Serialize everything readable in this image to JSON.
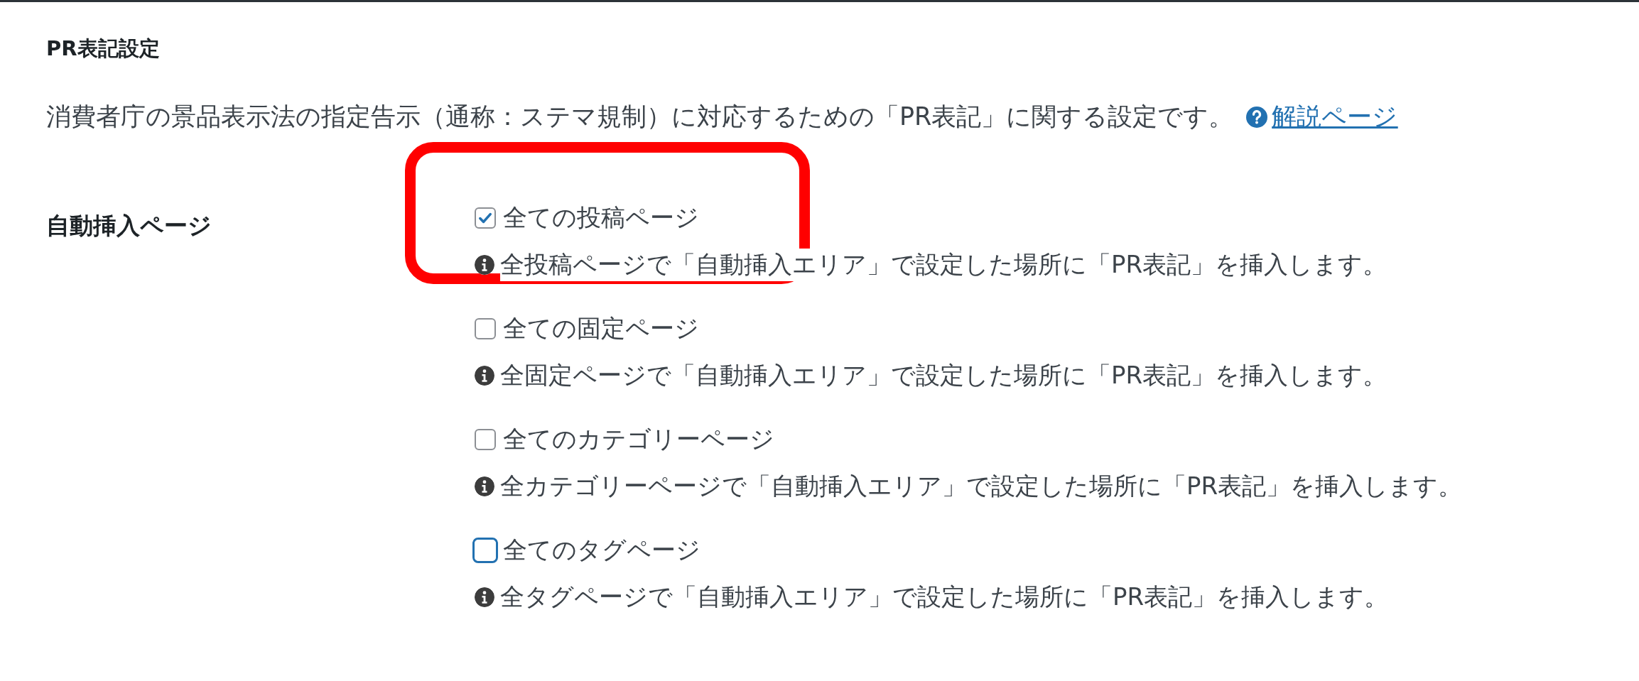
{
  "heading": "PR表記設定",
  "description": {
    "text": "消費者庁の景品表示法の指定告示（通称：ステマ規制）に対応するための「PR表記」に関する設定です。",
    "link": "解説ページ"
  },
  "field": {
    "label": "自動挿入ページ",
    "options": [
      {
        "label": "全ての投稿ページ",
        "checked": true,
        "focused": false,
        "highlighted": true,
        "help": "全投稿ページで「自動挿入エリア」で設定した場所に「PR表記」を挿入します。"
      },
      {
        "label": "全ての固定ページ",
        "checked": false,
        "focused": false,
        "highlighted": false,
        "help": "全固定ページで「自動挿入エリア」で設定した場所に「PR表記」を挿入します。"
      },
      {
        "label": "全てのカテゴリーページ",
        "checked": false,
        "focused": false,
        "highlighted": false,
        "help": "全カテゴリーページで「自動挿入エリア」で設定した場所に「PR表記」を挿入します。"
      },
      {
        "label": "全てのタグページ",
        "checked": false,
        "focused": true,
        "highlighted": false,
        "help": "全タグページで「自動挿入エリア」で設定した場所に「PR表記」を挿入します。"
      }
    ]
  }
}
